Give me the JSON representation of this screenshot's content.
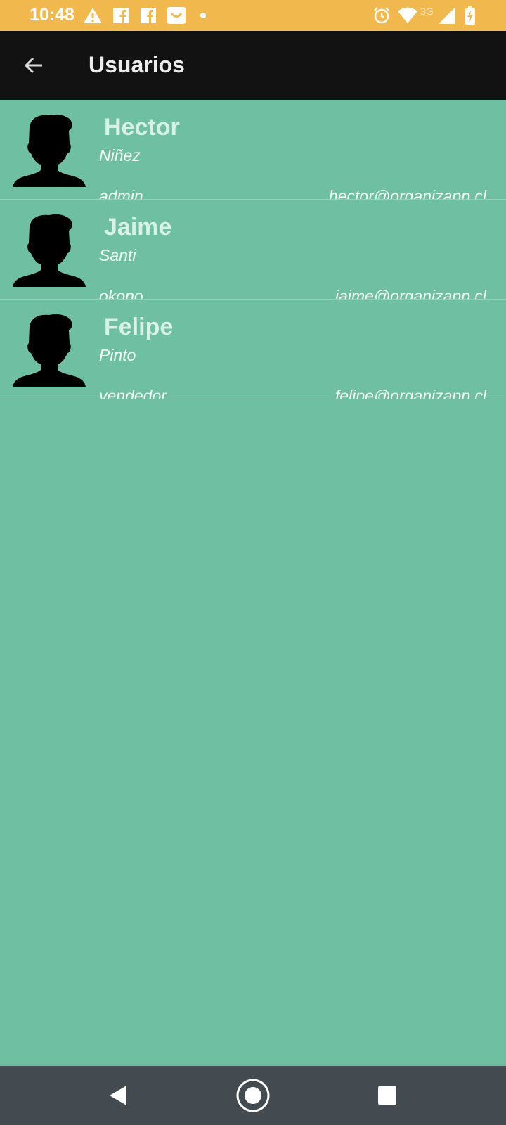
{
  "status_bar": {
    "time": "10:48",
    "network_label": "3G",
    "left_icons": [
      "warning-icon",
      "facebook-icon",
      "facebook-icon",
      "shopping-bag-icon",
      "dot-icon"
    ],
    "right_icons": [
      "alarm-icon",
      "wifi-icon",
      "signal-icon",
      "battery-charging-icon"
    ]
  },
  "app_bar": {
    "title": "Usuarios",
    "back_icon": "arrow-left-icon"
  },
  "users": [
    {
      "first_name": "Hector",
      "last_name": "Niñez",
      "role": "admin",
      "email": "hector@organizapp.cl"
    },
    {
      "first_name": "Jaime",
      "last_name": "Santi",
      "role": "okono",
      "email": "jaime@organizapp.cl"
    },
    {
      "first_name": "Felipe",
      "last_name": "Pinto",
      "role": "vendedor",
      "email": "felipe@organizapp.cl"
    }
  ],
  "nav_bar": {
    "icons": [
      "back-triangle-icon",
      "home-circle-icon",
      "recents-square-icon"
    ]
  },
  "colors": {
    "status_bar": "#f1b84d",
    "app_bar": "#121212",
    "content_bg": "#6fc0a3",
    "name_text": "#d9f2e8",
    "nav_bar": "#434a50"
  }
}
